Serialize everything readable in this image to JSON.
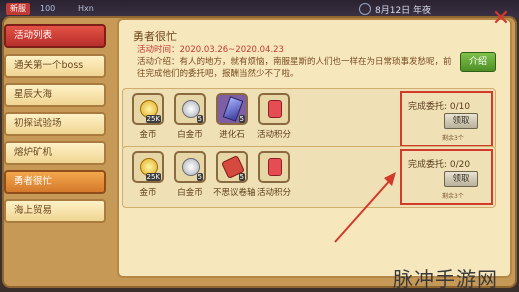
{
  "topbar": {
    "badge": "新服",
    "res1": "100",
    "res2": "Hxn",
    "date": "8月12日 年夜"
  },
  "sidebar": {
    "items": [
      {
        "label": "活动列表"
      },
      {
        "label": "通关第一个boss"
      },
      {
        "label": "星辰大海"
      },
      {
        "label": "初探试验场"
      },
      {
        "label": "熔炉矿机"
      },
      {
        "label": "勇者很忙"
      },
      {
        "label": "海上贸易"
      }
    ]
  },
  "panel": {
    "title": "勇者很忙",
    "date_line": "活动时间：2020.03.26~2020.04.23",
    "description": "活动介绍：有人的地方，就有烦恼，南服星斯的人们也一样在为日常琐事发愁呢，前往完成他们的委托吧，报酬当然少不了啦。",
    "intro_button": "介绍"
  },
  "rows": [
    {
      "rewards": [
        {
          "name": "金币",
          "qty": "25K"
        },
        {
          "name": "白金币",
          "qty": "5"
        },
        {
          "name": "进化石",
          "qty": "5"
        },
        {
          "name": "活动积分",
          "qty": ""
        }
      ],
      "status": "完成委托: 0/10",
      "claim": "领取",
      "remain": "剩余3个"
    },
    {
      "rewards": [
        {
          "name": "金币",
          "qty": "25K"
        },
        {
          "name": "白金币",
          "qty": "5"
        },
        {
          "name": "不思议卷轴",
          "qty": "5"
        },
        {
          "name": "活动积分",
          "qty": ""
        }
      ],
      "status": "完成委托: 0/20",
      "claim": "领取",
      "remain": "剩余3个"
    }
  ],
  "watermark": "脉冲手游网",
  "colors": {
    "accent_red": "#d23a2c",
    "panel_bg": "#f6e7bd",
    "frame": "#c69a56"
  }
}
